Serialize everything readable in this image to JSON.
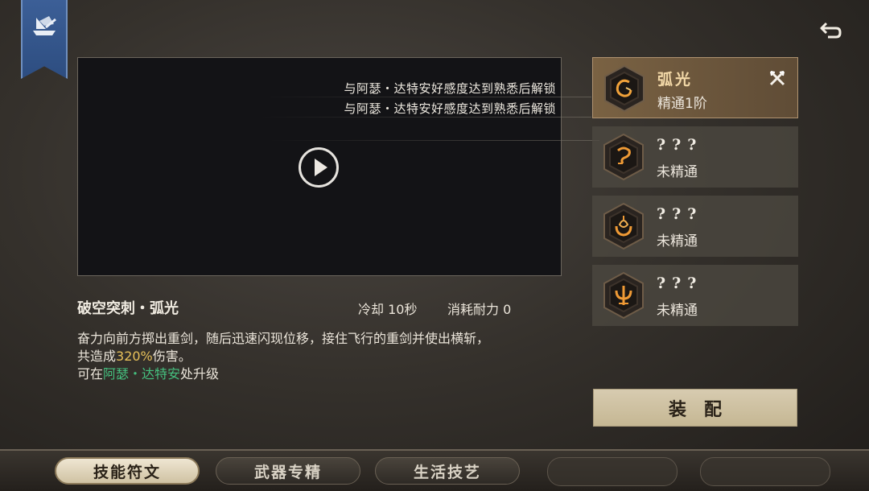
{
  "top": {
    "banner_icon": "guild-ship-banner-icon",
    "back_icon": "return-arrow-icon"
  },
  "video": {
    "unlock_lines": [
      "与阿瑟・达特安好感度达到熟悉后解锁",
      "与阿瑟・达特安好感度达到熟悉后解锁"
    ],
    "play_icon": "play-icon"
  },
  "skill": {
    "name": "破空突刺・弧光",
    "cooldown": "冷却 10秒",
    "cost": "消耗耐力 0",
    "desc_part1": "奋力向前方掷出重剑，随后迅速闪现位移，接住飞行的重剑并使出横斩，",
    "desc_part2_a": "共造成",
    "desc_damage": "320%",
    "desc_part2_b": "伤害。",
    "desc_part3_a": "可在",
    "desc_npc": "阿瑟・达特安",
    "desc_part3_b": "处升级"
  },
  "runes": [
    {
      "title": "弧光",
      "status": "精通1阶",
      "icon": "rune-arc-icon",
      "active": true,
      "equipped": true
    },
    {
      "title": "???",
      "status": "未精通",
      "icon": "rune-unknown-1-icon",
      "active": false
    },
    {
      "title": "???",
      "status": "未精通",
      "icon": "rune-unknown-2-icon",
      "active": false
    },
    {
      "title": "???",
      "status": "未精通",
      "icon": "rune-unknown-3-icon",
      "active": false
    }
  ],
  "equip_label": "装配",
  "tabs": [
    "技能符文",
    "武器专精",
    "生活技艺"
  ],
  "colors": {
    "highlight_gold": "#e8c15a",
    "npc_green": "#45c07f",
    "accent_rune": "#b09370"
  }
}
